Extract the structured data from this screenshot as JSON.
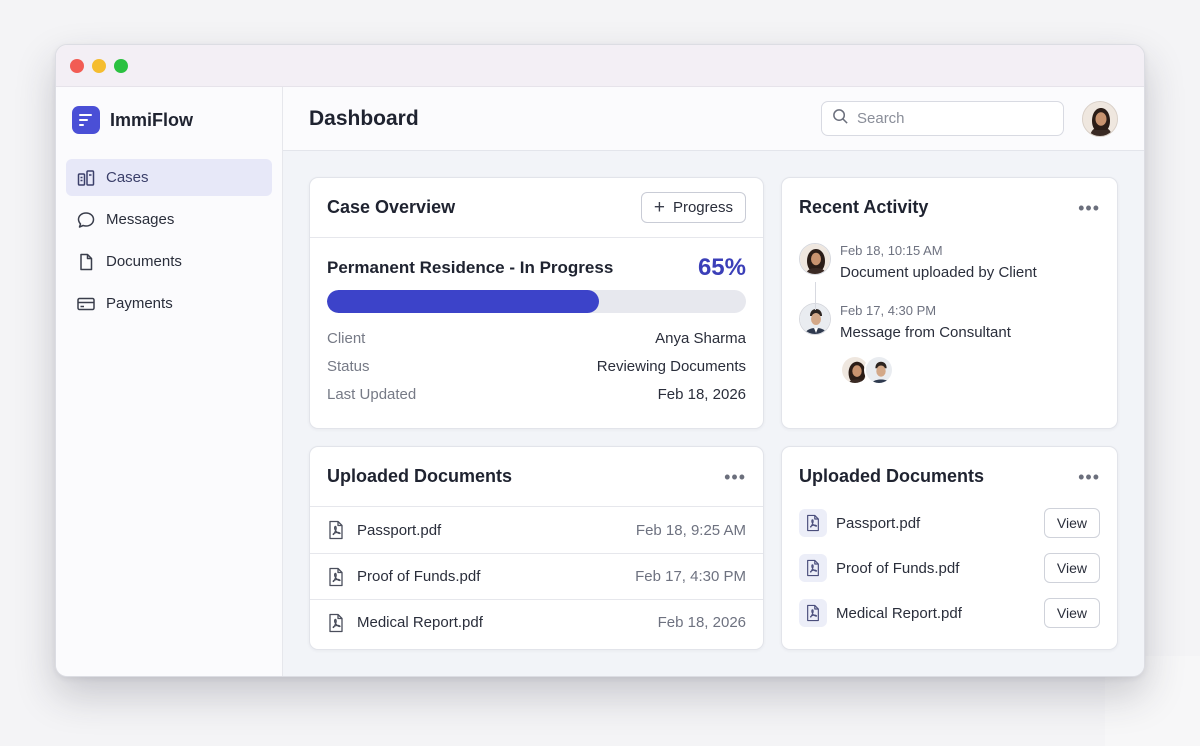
{
  "app": {
    "name": "ImmiFlow"
  },
  "sidebar": {
    "items": [
      {
        "label": "Cases",
        "icon": "cases-icon",
        "active": true
      },
      {
        "label": "Messages",
        "icon": "chat-bubble-icon",
        "active": false
      },
      {
        "label": "Documents",
        "icon": "document-icon",
        "active": false
      },
      {
        "label": "Payments",
        "icon": "credit-card-icon",
        "active": false
      }
    ]
  },
  "header": {
    "title": "Dashboard",
    "search_placeholder": "Search"
  },
  "case_overview": {
    "title": "Case Overview",
    "progress_button": "Progress",
    "case_name": "Permanent Residence - In Progress",
    "progress_label": "65%",
    "progress_value": 0.65,
    "details": [
      {
        "key": "Client",
        "value": "Anya Sharma"
      },
      {
        "key": "Status",
        "value": "Reviewing Documents"
      },
      {
        "key": "Last Updated",
        "value": "Feb 18, 2026"
      }
    ]
  },
  "recent_activity": {
    "title": "Recent Activity",
    "items": [
      {
        "time": "Feb 18, 10:15 AM",
        "text": "Document uploaded by Client"
      },
      {
        "time": "Feb 17, 4:30 PM",
        "text": "Message from Consultant"
      }
    ]
  },
  "uploaded_documents_list": {
    "title": "Uploaded Documents",
    "rows": [
      {
        "name": "Passport.pdf",
        "date": "Feb 18, 9:25 AM"
      },
      {
        "name": "Proof of Funds.pdf",
        "date": "Feb 17, 4:30 PM"
      },
      {
        "name": "Medical Report.pdf",
        "date": "Feb 18, 2026"
      }
    ]
  },
  "uploaded_documents_actions": {
    "title": "Uploaded Documents",
    "view_label": "View",
    "rows": [
      {
        "name": "Passport.pdf"
      },
      {
        "name": "Proof of Funds.pdf"
      },
      {
        "name": "Medical Report.pdf"
      }
    ]
  },
  "colors": {
    "accent": "#3c43c9",
    "brand": "#4a4fd6",
    "active_nav_bg": "#e7e8f8"
  }
}
